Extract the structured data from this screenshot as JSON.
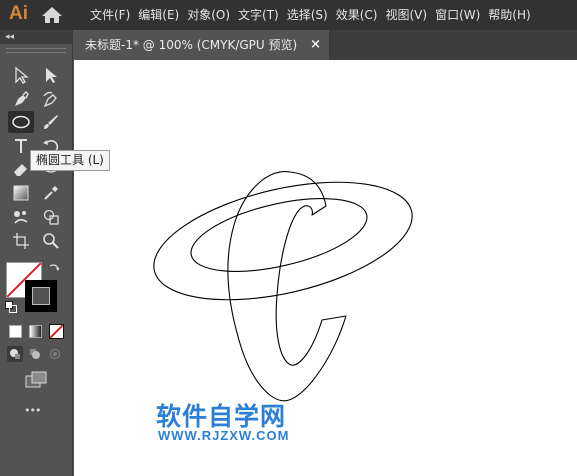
{
  "app": {
    "logo": "Ai"
  },
  "menu": {
    "items": [
      "文件(F)",
      "编辑(E)",
      "对象(O)",
      "文字(T)",
      "选择(S)",
      "效果(C)",
      "视图(V)",
      "窗口(W)",
      "帮助(H)"
    ]
  },
  "toolbar": {
    "collapse": "◂◂",
    "more": "•••",
    "tooltip": "椭圆工具 (L)",
    "fill_color": "#ffffff",
    "stroke_color": "#000000"
  },
  "document": {
    "tab_title": "未标题-1* @ 100% (CMYK/GPU 预览)",
    "close": "×"
  },
  "canvas": {
    "watermark_cn": "软件自学网",
    "watermark_url": "WWW.RJZXW.COM",
    "shape_stroke": "#000000",
    "watermark_color": "#2c7fd6"
  }
}
